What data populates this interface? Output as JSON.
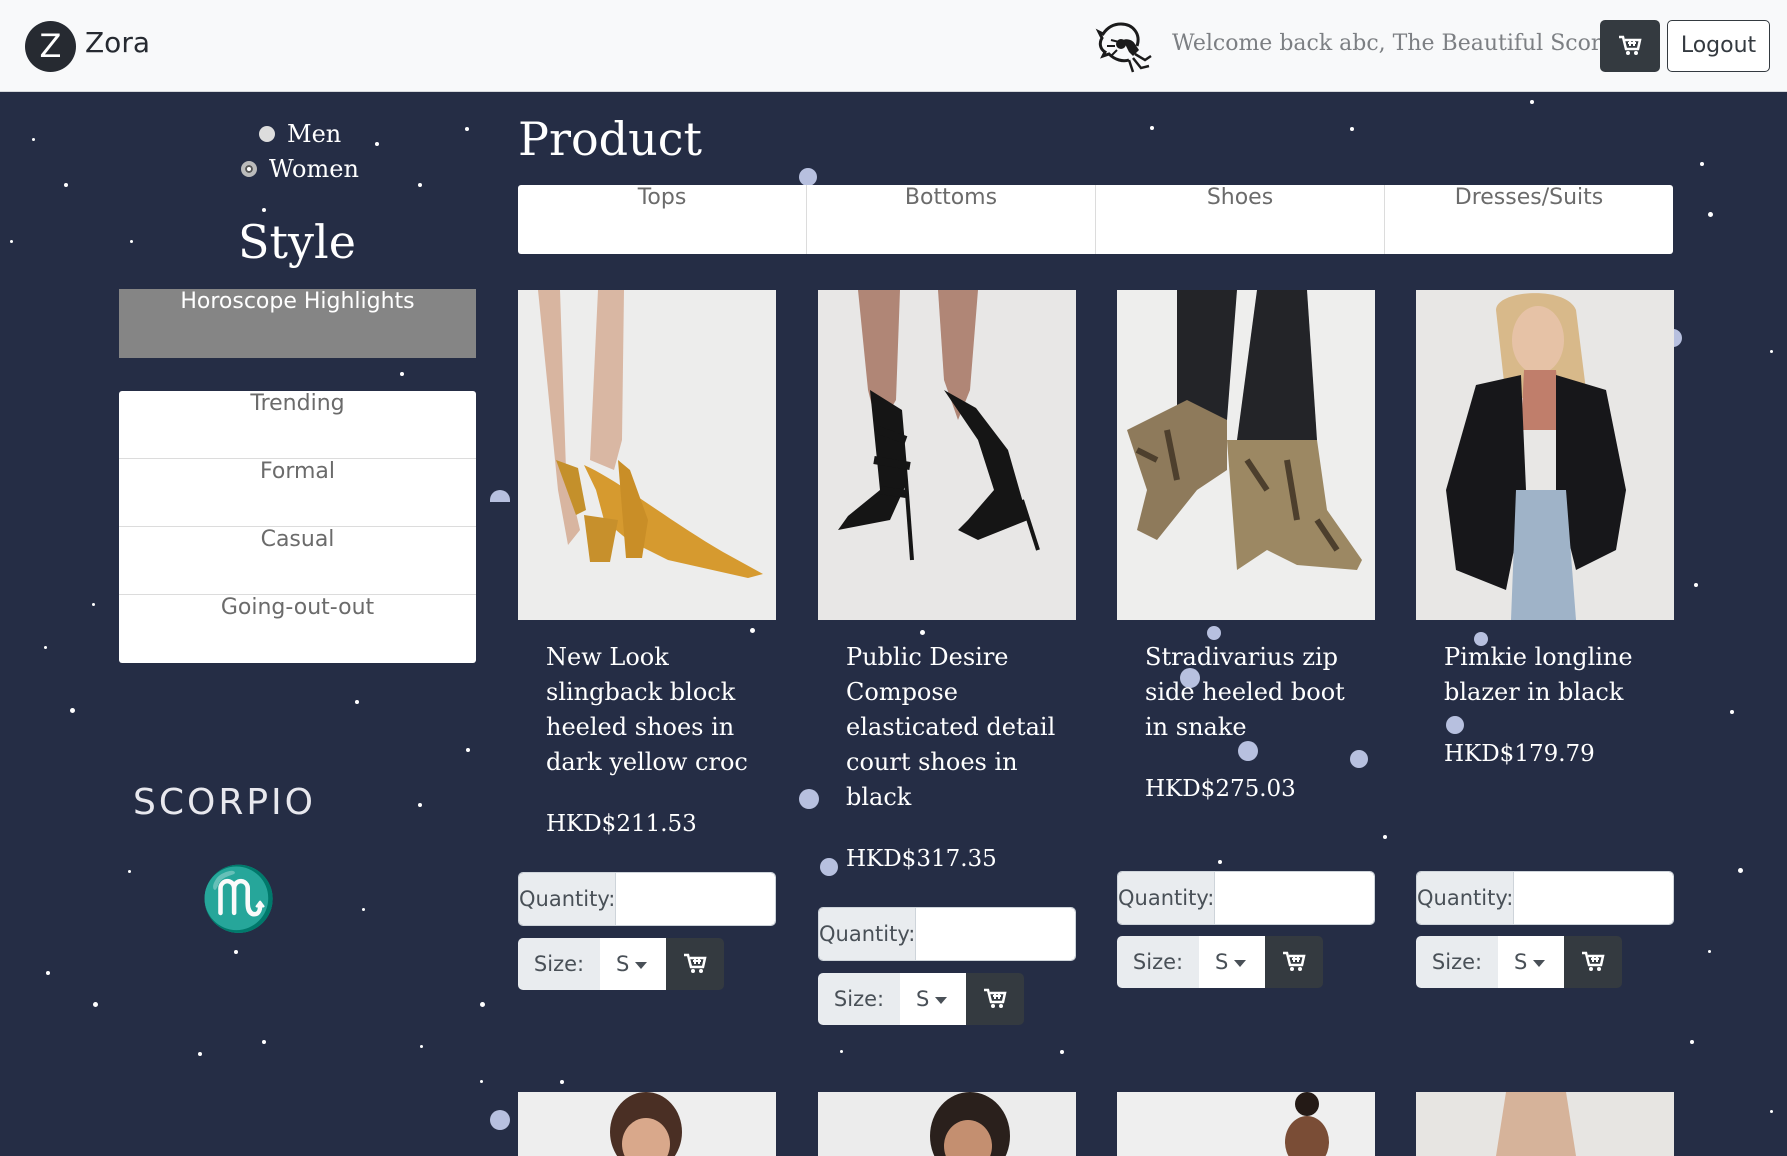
{
  "brand": {
    "logo_letter": "Z",
    "name": "Zora"
  },
  "navbar": {
    "welcome": "Welcome back abc, The Beautiful Scorpio",
    "logout_label": "Logout",
    "cart_icon": "cart-icon",
    "zodiac_icon": "scorpion-icon"
  },
  "sidebar": {
    "gender_options": [
      {
        "label": "Men",
        "selected": false
      },
      {
        "label": "Women",
        "selected": true
      }
    ],
    "style_heading": "Style",
    "highlight_label": "Horoscope Highlights",
    "style_items": [
      "Trending",
      "Formal",
      "Casual",
      "Going-out-out"
    ],
    "sign_name": "SCORPIO",
    "sign_glyph": "♏"
  },
  "main": {
    "title": "Product",
    "tabs": [
      "Tops",
      "Bottoms",
      "Shoes",
      "Dresses/Suits"
    ],
    "products": [
      {
        "name": "New Look slingback block heeled shoes in dark yellow croc",
        "price": "HKD$211.53",
        "image": "mustard-slingback-heels",
        "quantity": "",
        "size": "S"
      },
      {
        "name": "Public Desire Compose elasticated detail court shoes in black",
        "price": "HKD$317.35",
        "image": "black-strappy-heels",
        "quantity": "",
        "size": "S"
      },
      {
        "name": "Stradivarius zip side heeled boot in snake",
        "price": "HKD$275.03",
        "image": "snakeskin-ankle-boots",
        "quantity": "",
        "size": "S"
      },
      {
        "name": "Pimkie longline blazer in black",
        "price": "HKD$179.79",
        "image": "woman-black-blazer",
        "quantity": "",
        "size": "S"
      }
    ],
    "quantity_label": "Quantity:",
    "size_label": "Size:"
  },
  "colors": {
    "background": "#252d45",
    "navbar": "#f8f9fa",
    "dark_button": "#343a40",
    "highlight": "#858585"
  }
}
